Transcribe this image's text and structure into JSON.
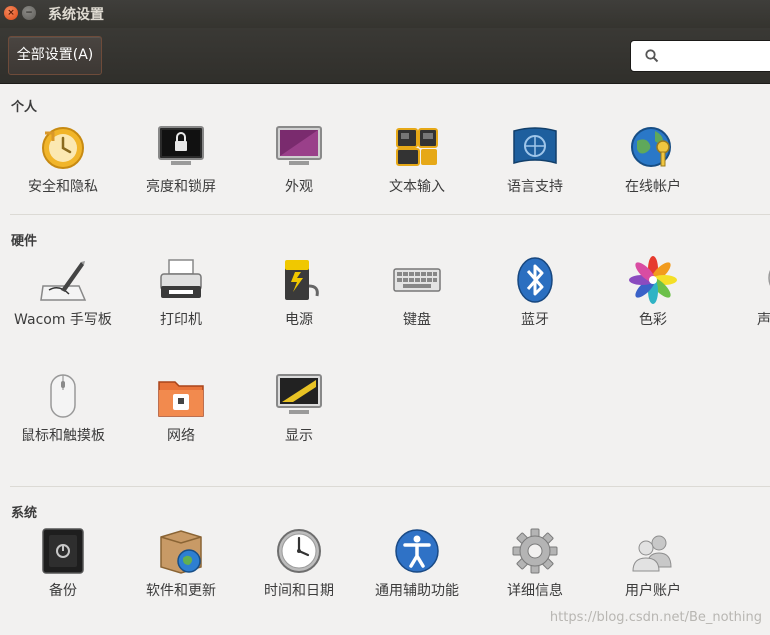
{
  "window": {
    "title": "系统设置"
  },
  "toolbar": {
    "all_settings_label": "全部设置(A)",
    "search_placeholder": ""
  },
  "sections": {
    "personal": {
      "title": "个人",
      "items": [
        {
          "label": "安全和隐私",
          "icon": "security-privacy-icon"
        },
        {
          "label": "亮度和锁屏",
          "icon": "brightness-lock-icon"
        },
        {
          "label": "外观",
          "icon": "appearance-icon"
        },
        {
          "label": "文本输入",
          "icon": "text-entry-icon"
        },
        {
          "label": "语言支持",
          "icon": "language-support-icon"
        },
        {
          "label": "在线帐户",
          "icon": "online-accounts-icon"
        }
      ]
    },
    "hardware": {
      "title": "硬件",
      "items": [
        {
          "label": "Wacom 手写板",
          "icon": "wacom-tablet-icon"
        },
        {
          "label": "打印机",
          "icon": "printer-icon"
        },
        {
          "label": "电源",
          "icon": "power-icon"
        },
        {
          "label": "键盘",
          "icon": "keyboard-icon"
        },
        {
          "label": "蓝牙",
          "icon": "bluetooth-icon"
        },
        {
          "label": "色彩",
          "icon": "color-icon"
        },
        {
          "label": "声",
          "icon": "sound-icon"
        },
        {
          "label": "鼠标和触摸板",
          "icon": "mouse-touchpad-icon"
        },
        {
          "label": "网络",
          "icon": "network-icon"
        },
        {
          "label": "显示",
          "icon": "display-icon"
        }
      ]
    },
    "system": {
      "title": "系统",
      "items": [
        {
          "label": "备份",
          "icon": "backup-icon"
        },
        {
          "label": "软件和更新",
          "icon": "software-updates-icon"
        },
        {
          "label": "时间和日期",
          "icon": "time-date-icon"
        },
        {
          "label": "通用辅助功能",
          "icon": "universal-access-icon"
        },
        {
          "label": "详细信息",
          "icon": "details-icon"
        },
        {
          "label": "用户账户",
          "icon": "user-accounts-icon"
        }
      ]
    }
  },
  "watermark": "https://blog.csdn.net/Be_nothing"
}
